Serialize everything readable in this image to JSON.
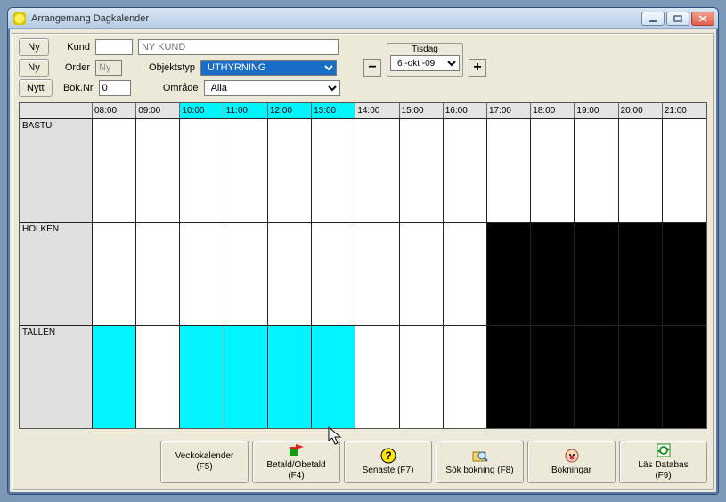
{
  "window": {
    "title": "Arrangemang Dagkalender"
  },
  "form": {
    "ny_btn": "Ny",
    "ny_btn2": "Ny",
    "nytt_btn": "Nytt",
    "kund_label": "Kund",
    "kund_value": "",
    "kund_name_placeholder": "NY KUND",
    "order_label": "Order",
    "order_value": "Ny",
    "objektstyp_label": "Objektstyp",
    "objektstyp_value": "UTHYRNING",
    "boknr_label": "Bok.Nr",
    "boknr_value": "0",
    "omrade_label": "Område",
    "omrade_value": "Alla",
    "day_label": "Tisdag",
    "day_value": "6 -okt -09",
    "minus": "−",
    "plus": "+"
  },
  "calendar": {
    "hours": [
      "08:00",
      "09:00",
      "10:00",
      "11:00",
      "12:00",
      "13:00",
      "14:00",
      "15:00",
      "16:00",
      "17:00",
      "18:00",
      "19:00",
      "20:00",
      "21:00"
    ],
    "highlight_hours": [
      "10:00",
      "11:00",
      "12:00",
      "13:00"
    ],
    "resources": [
      {
        "name": "BASTU",
        "cells_cyan": [],
        "cells_black": []
      },
      {
        "name": "HOLKEN",
        "cells_cyan": [],
        "cells_black": [
          "17:00",
          "18:00",
          "19:00",
          "20:00",
          "21:00"
        ]
      },
      {
        "name": "TALLEN",
        "cells_cyan": [
          "08:00",
          "10:00",
          "11:00",
          "12:00",
          "13:00"
        ],
        "cells_black": [
          "17:00",
          "18:00",
          "19:00",
          "20:00",
          "21:00"
        ]
      }
    ]
  },
  "footer": {
    "veckokalender": "Veckokalender\n(F5)",
    "betald": "Betald/Obetald\n(F4)",
    "senaste": "Senaste (F7)",
    "sok": "Sök bokning (F8)",
    "bokningar": "Bokningar",
    "lasdb": "Läs Databas\n(F9)"
  }
}
